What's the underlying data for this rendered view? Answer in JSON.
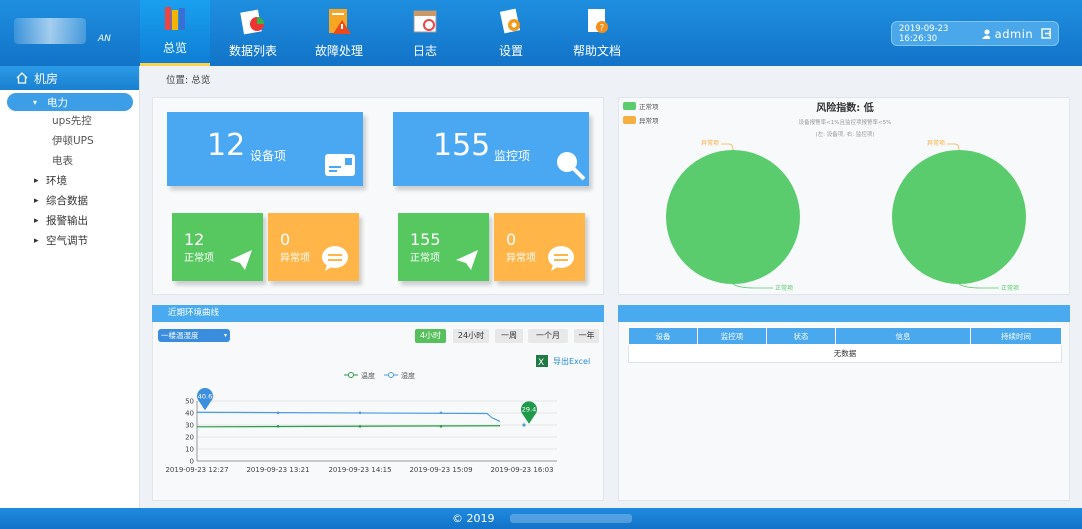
{
  "header": {
    "logo_text": "AN",
    "nav": [
      {
        "label": "总览",
        "icon": "books-icon"
      },
      {
        "label": "数据列表",
        "icon": "chart-list-icon"
      },
      {
        "label": "故障处理",
        "icon": "warning-doc-icon"
      },
      {
        "label": "日志",
        "icon": "calendar-icon"
      },
      {
        "label": "设置",
        "icon": "gear-doc-icon"
      },
      {
        "label": "帮助文档",
        "icon": "help-doc-icon"
      }
    ],
    "datetime": "2019-09-23  16:26:30",
    "user": "admin"
  },
  "sidebar": {
    "title": "机房",
    "selected": "电力",
    "sub_items": [
      "ups先控",
      "伊顿UPS",
      "电表"
    ],
    "categories": [
      "环境",
      "综合数据",
      "报警输出",
      "空气调节"
    ]
  },
  "breadcrumb": "位置: 总览",
  "stats": {
    "device_count": "12",
    "device_label": "设备项",
    "monitor_count": "155",
    "monitor_label": "监控项",
    "dev_normal": "12",
    "dev_abnormal": "0",
    "mon_normal": "155",
    "mon_abnormal": "0",
    "normal_label": "正常项",
    "abnormal_label": "异常项"
  },
  "risk": {
    "legend_normal": "正常项",
    "legend_abnormal": "异常项",
    "title": "风险指数: 低",
    "subtitle": "设备报警率<1%且监控项报警率<5%",
    "note": "(左: 设备项, 右: 监控项)",
    "pie_top_label": "异常项",
    "pie_bottom_label": "正常项"
  },
  "env": {
    "title": "近期环境曲线",
    "select_value": "一楼温湿度",
    "buttons": [
      "4小时",
      "24小时",
      "一周",
      "一个月",
      "一年"
    ],
    "export": "导出Excel"
  },
  "alarms": {
    "columns": [
      "设备",
      "监控项",
      "状态",
      "信息",
      "持续时间"
    ],
    "empty": "无数据"
  },
  "chart_data": {
    "type": "line",
    "series": [
      {
        "name": "温度",
        "color": "#2a9d4a"
      },
      {
        "name": "湿度",
        "color": "#4a9de0"
      }
    ],
    "x_ticks": [
      "2019-09-23 12:27",
      "2019-09-23 13:21",
      "2019-09-23 14:15",
      "2019-09-23 15:09",
      "2019-09-23 16:03"
    ],
    "ylim": [
      0,
      50
    ],
    "y_ticks": [
      "0",
      "10",
      "20",
      "30",
      "40",
      "50"
    ],
    "markers": [
      "40.6",
      "29.4"
    ]
  },
  "footer": "© 2019"
}
